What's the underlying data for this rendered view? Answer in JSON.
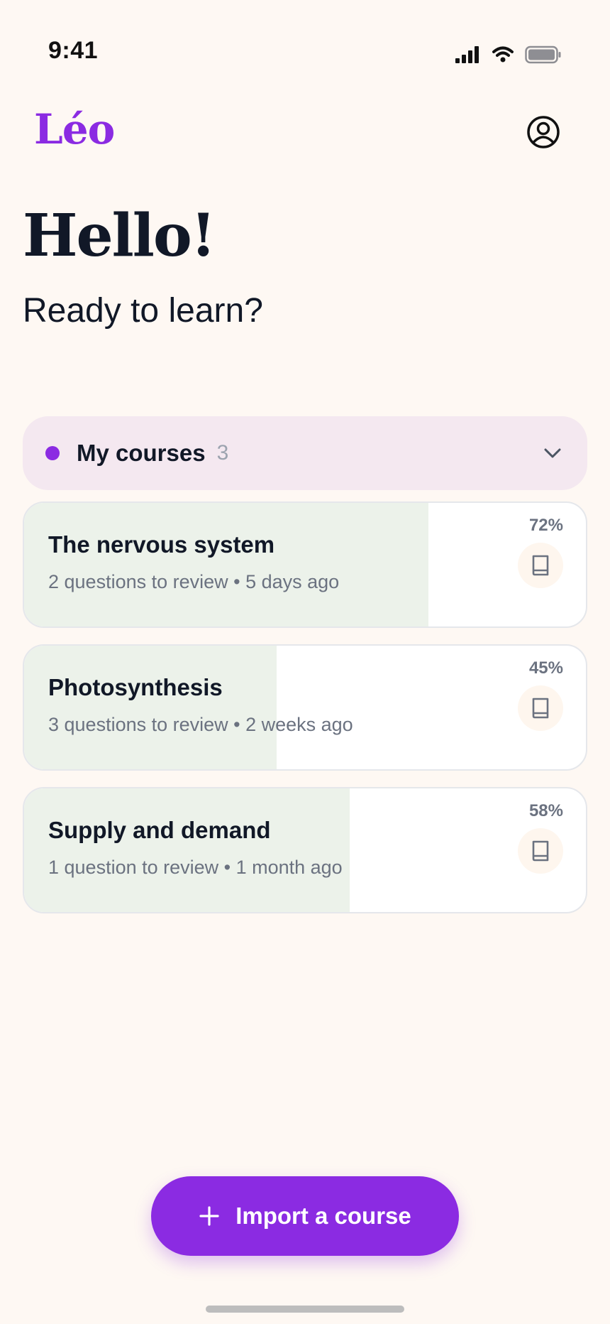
{
  "status_bar": {
    "time": "9:41"
  },
  "header": {
    "logo": "Léo"
  },
  "greeting": {
    "title": "Hello!",
    "subtitle": "Ready to learn?"
  },
  "courses": {
    "title": "My courses",
    "count": "3",
    "items": [
      {
        "title": "The nervous system",
        "meta": "2 questions to review • 5 days ago",
        "progress_label": "72%",
        "progress": 0.72
      },
      {
        "title": "Photosynthesis",
        "meta": "3 questions to review • 2 weeks ago",
        "progress_label": "45%",
        "progress": 0.45
      },
      {
        "title": "Supply and demand",
        "meta": "1 question to review • 1 month ago",
        "progress_label": "58%",
        "progress": 0.58
      }
    ]
  },
  "import_button": {
    "label": "Import a course"
  },
  "colors": {
    "accent": "#8B2BE2",
    "background": "#FEF8F3",
    "progress_fill": "#ECF2EA"
  },
  "icons": {
    "profile": "user-circle-icon",
    "chevron": "chevron-down-icon",
    "course": "book-icon",
    "add": "plus-icon"
  }
}
